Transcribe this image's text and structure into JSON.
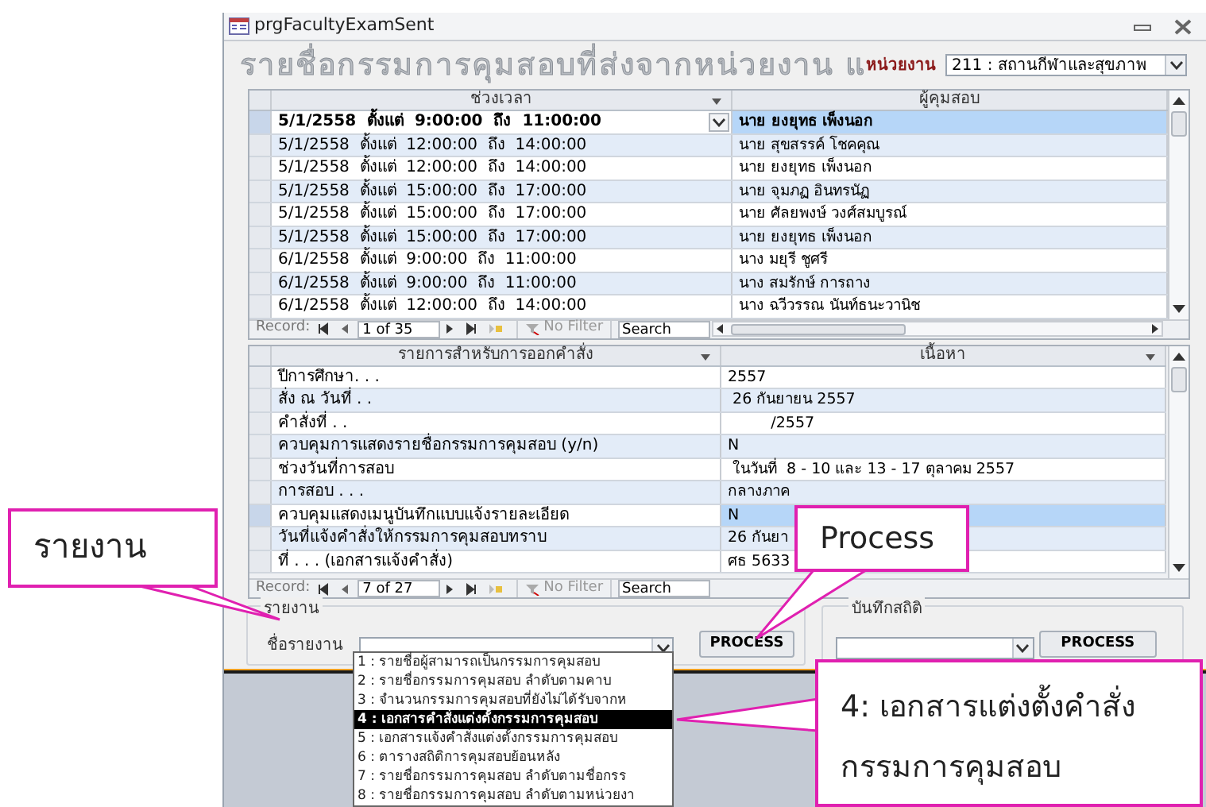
{
  "window": {
    "title": "prgFacultyExamSent"
  },
  "header": {
    "title": "รายชื่อกรรมการคุมสอบที่ส่งจากหน่วยงาน แ",
    "unit_label": "หน่วยงาน",
    "unit_value": "211 : สถานกีฬาและสุขภาพ"
  },
  "schedule_grid": {
    "columns": [
      "ช่วงเวลา",
      "ผู้คุมสอบ"
    ],
    "rows": [
      {
        "time": "5/1/2558  ตั้งแต่  9:00:00  ถึง  11:00:00",
        "proctor": "นาย ยงยุทธ เพ็งนอก",
        "selected": true
      },
      {
        "time": "5/1/2558  ตั้งแต่  12:00:00  ถึง  14:00:00",
        "proctor": "นาย สุขสรรค์ โชคคุณ",
        "selected": false
      },
      {
        "time": "5/1/2558  ตั้งแต่  12:00:00  ถึง  14:00:00",
        "proctor": "นาย ยงยุทธ เพ็งนอก",
        "selected": false
      },
      {
        "time": "5/1/2558  ตั้งแต่  15:00:00  ถึง  17:00:00",
        "proctor": "นาย จุมภฏ อินทรนัฏ",
        "selected": false
      },
      {
        "time": "5/1/2558  ตั้งแต่  15:00:00  ถึง  17:00:00",
        "proctor": "นาย ศัลยพงษ์ วงศ์สมบูรณ์",
        "selected": false
      },
      {
        "time": "5/1/2558  ตั้งแต่  15:00:00  ถึง  17:00:00",
        "proctor": "นาย ยงยุทธ เพ็งนอก",
        "selected": false
      },
      {
        "time": "6/1/2558  ตั้งแต่  9:00:00  ถึง  11:00:00",
        "proctor": "นาง มยุรี ชูศรี",
        "selected": false
      },
      {
        "time": "6/1/2558  ตั้งแต่  9:00:00  ถึง  11:00:00",
        "proctor": "นาง สมรักษ์ การถาง",
        "selected": false
      },
      {
        "time": "6/1/2558  ตั้งแต่  12:00:00  ถึง  14:00:00",
        "proctor": "นาง ฉวีวรรณ นันท์ธนะวานิช",
        "selected": false
      }
    ],
    "record_bar": {
      "label": "Record:",
      "position": "1 of 35",
      "filter": "No Filter",
      "search": "Search"
    }
  },
  "order_grid": {
    "columns": [
      "รายการสำหรับการออกคำสั่ง",
      "เนื้อหา"
    ],
    "rows": [
      {
        "item": "ปีการศึกษา. . .",
        "content": "2557",
        "selected": false
      },
      {
        "item": "สั่ง ณ วันที่ . .",
        "content": " 26 กันยายน 2557",
        "selected": false
      },
      {
        "item": "คำสั่งที่ . .",
        "content": "         /2557",
        "selected": false
      },
      {
        "item": "ควบคุมการแสดงรายชื่อกรรมการคุมสอบ (y/n)",
        "content": "N",
        "selected": false
      },
      {
        "item": "ช่วงวันที่การสอบ",
        "content": " ในวันที่  8 - 10 และ 13 - 17 ตุลาคม 2557",
        "selected": false
      },
      {
        "item": "การสอบ . . .",
        "content": "กลางภาค",
        "selected": false
      },
      {
        "item": "ควบคุมแสดงเมนูบันทึกแบบแจ้งรายละเอียด",
        "content": "N",
        "selected": true
      },
      {
        "item": "วันที่แจ้งคำสั่งให้กรรมการคุมสอบทราบ",
        "content": "26 กันยา",
        "selected": false
      },
      {
        "item": "ที่ . . . (เอกสารแจ้งคำสั่ง)",
        "content": "ศธ 5633",
        "selected": false
      }
    ],
    "record_bar": {
      "label": "Record:",
      "position": "7 of 27",
      "filter": "No Filter",
      "search": "Search"
    }
  },
  "report_group": {
    "title": "รายงาน",
    "field_label": "ชื่อรายงาน",
    "button": "PROCESS",
    "options": [
      {
        "label": "1 : รายชื่อผู้สามารถเป็นกรรมการคุมสอบ",
        "selected": false
      },
      {
        "label": "2 : รายชื่อกรรมการคุมสอบ ลำดับตามคาบ",
        "selected": false
      },
      {
        "label": "3 : จำนวนกรรมการคุมสอบที่ยังไม่ได้รับจากห",
        "selected": false
      },
      {
        "label": "4 : เอกสารคำสั่งแต่งตั้งกรรมการคุมสอบ",
        "selected": true
      },
      {
        "label": "5 : เอกสารแจ้งคำสั่งแต่งตั้งกรรมการคุมสอบ",
        "selected": false
      },
      {
        "label": "6 : ตารางสถิติการคุมสอบย้อนหลัง",
        "selected": false
      },
      {
        "label": "7 : รายชื่อกรรมการคุมสอบ ลำดับตามชื่อกรร",
        "selected": false
      },
      {
        "label": "8 : รายชื่อกรรมการคุมสอบ ลำดับตามหน่วยงา",
        "selected": false
      }
    ]
  },
  "stats_group": {
    "title": "บันทึกสถิติ",
    "button": "PROCESS"
  },
  "callouts": [
    {
      "lines": [
        "รายงาน"
      ]
    },
    {
      "lines": [
        "Process"
      ]
    },
    {
      "lines": [
        "4: เอกสารแต่งตั้งคำสั่ง",
        "กรรมการคุมสอบ"
      ]
    }
  ]
}
